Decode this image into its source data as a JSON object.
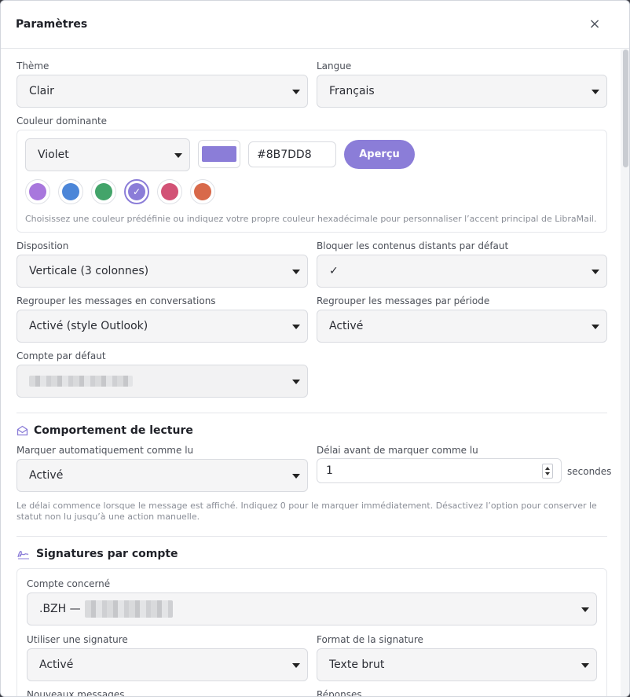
{
  "dialog": {
    "title": "Paramètres",
    "close_glyph": "×"
  },
  "theme": {
    "label": "Thème",
    "value": "Clair"
  },
  "language": {
    "label": "Langue",
    "value": "Français"
  },
  "accent": {
    "label": "Couleur dominante",
    "preset_value": "Violet",
    "color": "#8B7DD8",
    "hex_value": "#8B7DD8",
    "preview_button": "Aperçu",
    "swatches": [
      {
        "name": "violet-clair",
        "color": "#A877DD",
        "selected": false
      },
      {
        "name": "bleu",
        "color": "#4C86D8",
        "selected": false
      },
      {
        "name": "vert",
        "color": "#43A46A",
        "selected": false
      },
      {
        "name": "violet",
        "color": "#8B7DD8",
        "selected": true
      },
      {
        "name": "rose",
        "color": "#D25276",
        "selected": false
      },
      {
        "name": "orange",
        "color": "#D8694A",
        "selected": false
      }
    ],
    "help": "Choisissez une couleur prédéfinie ou indiquez votre propre couleur hexadécimale pour personnaliser l’accent principal de LibraMail."
  },
  "layout": {
    "label": "Disposition",
    "value": "Verticale (3 colonnes)"
  },
  "block_remote": {
    "label": "Bloquer les contenus distants par défaut",
    "value": "✓"
  },
  "group_conversations": {
    "label": "Regrouper les messages en conversations",
    "value": "Activé (style Outlook)"
  },
  "group_period": {
    "label": "Regrouper les messages par période",
    "value": "Activé"
  },
  "default_account": {
    "label": "Compte par défaut",
    "value": ""
  },
  "reading": {
    "title": "Comportement de lecture",
    "auto_mark_label": "Marquer automatiquement comme lu",
    "auto_mark_value": "Activé",
    "delay_label": "Délai avant de marquer comme lu",
    "delay_value": "1",
    "delay_unit": "secondes",
    "help": "Le délai commence lorsque le message est affiché. Indiquez 0 pour le marquer immédiatement. Désactivez l’option pour conserver le statut non lu jusqu’à une action manuelle."
  },
  "signatures": {
    "title": "Signatures par compte",
    "account_label": "Compte concerné",
    "account_value": ".BZH —",
    "use_label": "Utiliser une signature",
    "use_value": "Activé",
    "format_label": "Format de la signature",
    "format_value": "Texte brut",
    "new_messages_label": "Nouveaux messages",
    "replies_label": "Réponses"
  }
}
